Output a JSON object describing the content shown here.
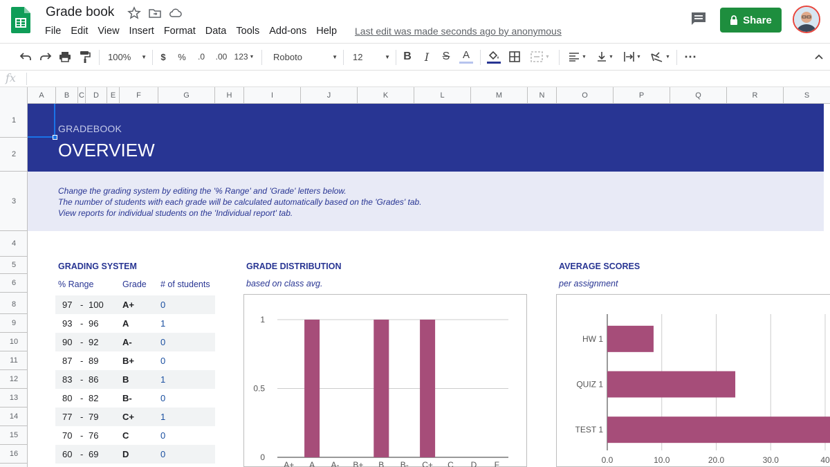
{
  "app": {
    "title": "Grade book",
    "menus": [
      "File",
      "Edit",
      "View",
      "Insert",
      "Format",
      "Data",
      "Tools",
      "Add-ons",
      "Help"
    ],
    "last_edit": "Last edit was made seconds ago by anonymous",
    "share_label": "Share"
  },
  "toolbar": {
    "zoom": "100%",
    "currency": "$",
    "percent": "%",
    "decrease_decimal": ".0",
    "increase_decimal": ".00",
    "more_formats": "123",
    "font": "Roboto",
    "font_size": "12",
    "accent_text": "#283593",
    "fill_color": "#283593"
  },
  "formula_bar": {
    "fx": "fx"
  },
  "grid": {
    "columns": [
      "A",
      "B",
      "C",
      "D",
      "E",
      "F",
      "G",
      "H",
      "I",
      "J",
      "K",
      "L",
      "M",
      "N",
      "O",
      "P",
      "Q",
      "R",
      "S"
    ],
    "rows": [
      "1",
      "2",
      "3",
      "4",
      "5",
      "6",
      "8",
      "9",
      "10",
      "11",
      "12",
      "13",
      "14",
      "15",
      "16"
    ]
  },
  "sheet": {
    "banner_subtitle": "GRADEBOOK",
    "banner_title": "OVERVIEW",
    "info_lines": [
      "Change the grading system by editing the '% Range' and 'Grade' letters below.",
      "The number of students with each grade will be calculated automatically based on the 'Grades' tab.",
      "View reports for individual students on the 'Individual report' tab."
    ],
    "grading_system": {
      "title": "GRADING SYSTEM",
      "headers": [
        "% Range",
        "Grade",
        "# of students"
      ],
      "rows": [
        {
          "min": "97",
          "dash": "-",
          "max": "100",
          "grade": "A+",
          "count": "0"
        },
        {
          "min": "93",
          "dash": "-",
          "max": "96",
          "grade": "A",
          "count": "1"
        },
        {
          "min": "90",
          "dash": "-",
          "max": "92",
          "grade": "A-",
          "count": "0"
        },
        {
          "min": "87",
          "dash": "-",
          "max": "89",
          "grade": "B+",
          "count": "0"
        },
        {
          "min": "83",
          "dash": "-",
          "max": "86",
          "grade": "B",
          "count": "1"
        },
        {
          "min": "80",
          "dash": "-",
          "max": "82",
          "grade": "B-",
          "count": "0"
        },
        {
          "min": "77",
          "dash": "-",
          "max": "79",
          "grade": "C+",
          "count": "1"
        },
        {
          "min": "70",
          "dash": "-",
          "max": "76",
          "grade": "C",
          "count": "0"
        },
        {
          "min": "60",
          "dash": "-",
          "max": "69",
          "grade": "D",
          "count": "0"
        }
      ]
    },
    "grade_distribution": {
      "title": "GRADE DISTRIBUTION",
      "subtitle": "based on class avg."
    },
    "average_scores": {
      "title": "AVERAGE SCORES",
      "subtitle": "per assignment"
    }
  },
  "chart_data": [
    {
      "type": "bar",
      "title": "",
      "categories": [
        "A+",
        "A",
        "A-",
        "B+",
        "B",
        "B-",
        "C+",
        "C",
        "D",
        "F"
      ],
      "values": [
        0,
        1,
        0,
        0,
        1,
        0,
        1,
        0,
        0,
        0
      ],
      "ylim": [
        0,
        1
      ],
      "y_ticks": [
        "0",
        "0.5",
        "1"
      ],
      "grid": true,
      "color": "#a64d79"
    },
    {
      "type": "bar",
      "orientation": "horizontal",
      "title": "",
      "categories": [
        "HW 1",
        "QUIZ 1",
        "TEST 1"
      ],
      "values": [
        8.5,
        23.5,
        42
      ],
      "xlim": [
        0,
        40
      ],
      "x_ticks": [
        "0.0",
        "10.0",
        "20.0",
        "30.0",
        "40"
      ],
      "grid": true,
      "color": "#a64d79"
    }
  ]
}
